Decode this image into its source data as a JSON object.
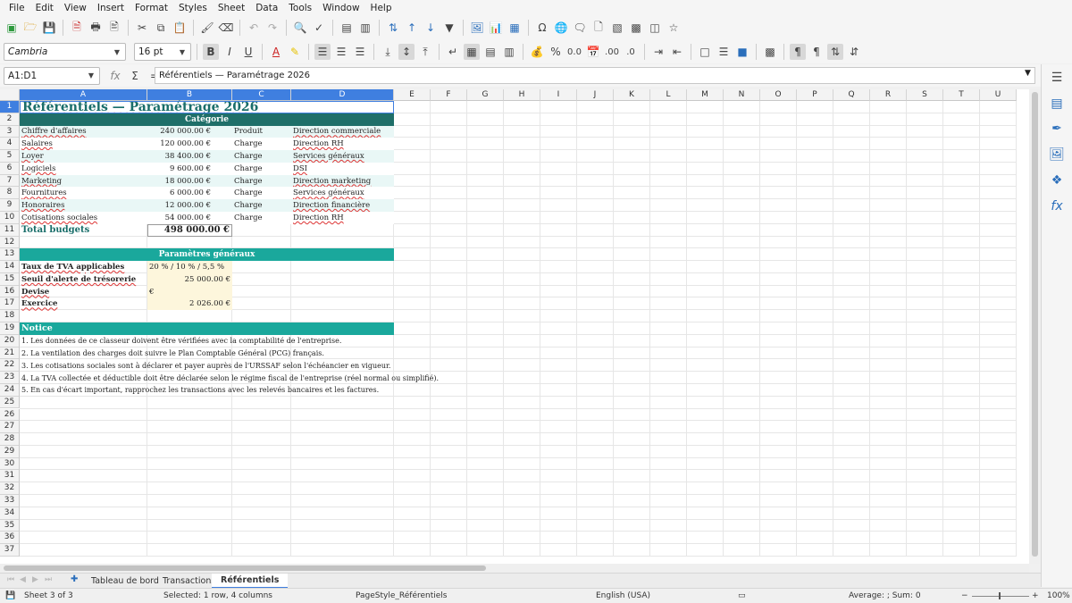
{
  "menu": [
    "File",
    "Edit",
    "View",
    "Insert",
    "Format",
    "Styles",
    "Sheet",
    "Data",
    "Tools",
    "Window",
    "Help"
  ],
  "font_name": "Cambria",
  "font_size": "16 pt",
  "name_box": "A1:D1",
  "formula_text": "Référentiels — Paramétrage 2026",
  "columns": [
    "A",
    "B",
    "C",
    "D",
    "E",
    "F",
    "G",
    "H",
    "I",
    "J",
    "K",
    "L",
    "M",
    "N",
    "O",
    "P",
    "Q",
    "R",
    "S",
    "T",
    "U"
  ],
  "rows": [
    "1",
    "2",
    "3",
    "4",
    "5",
    "6",
    "7",
    "8",
    "9",
    "10",
    "11",
    "12",
    "13",
    "14",
    "15",
    "16",
    "17",
    "18",
    "19",
    "20",
    "21",
    "22",
    "23",
    "24",
    "25",
    "26",
    "27",
    "28",
    "29",
    "30",
    "31",
    "32",
    "33",
    "34",
    "35",
    "36",
    "37"
  ],
  "sheet": {
    "title": "Référentiels — Paramétrage 2026",
    "category_header": "Catégorie",
    "budget_rows": [
      {
        "a": "Chiffre d'affaires",
        "b": "240 000.00 €",
        "c": "Produit",
        "d": "Direction commerciale"
      },
      {
        "a": "Salaires",
        "b": "120 000.00 €",
        "c": "Charge",
        "d": "Direction RH"
      },
      {
        "a": "Loyer",
        "b": "38 400.00 €",
        "c": "Charge",
        "d": "Services généraux"
      },
      {
        "a": "Logiciels",
        "b": "9 600.00 €",
        "c": "Charge",
        "d": "DSI"
      },
      {
        "a": "Marketing",
        "b": "18 000.00 €",
        "c": "Charge",
        "d": "Direction marketing"
      },
      {
        "a": "Fournitures",
        "b": "6 000.00 €",
        "c": "Charge",
        "d": "Services généraux"
      },
      {
        "a": "Honoraires",
        "b": "12 000.00 €",
        "c": "Charge",
        "d": "Direction financière"
      },
      {
        "a": "Cotisations sociales",
        "b": "54 000.00 €",
        "c": "Charge",
        "d": "Direction RH"
      }
    ],
    "total_label": "Total budgets",
    "total_value": "498 000.00 €",
    "params_header": "Paramètres généraux",
    "params": [
      {
        "label": "Taux de TVA applicables",
        "value": "20 % / 10 % / 5,5 %",
        "align": "left"
      },
      {
        "label": "Seuil d'alerte de trésorerie",
        "value": "25 000.00 €",
        "align": "right"
      },
      {
        "label": "Devise",
        "value": "€",
        "align": "left"
      },
      {
        "label": "Exercice",
        "value": "2 026.00 €",
        "align": "right"
      }
    ],
    "notice_header": "Notice",
    "notices": [
      "1. Les données de ce classeur doivent être vérifiées avec la comptabilité de l'entreprise.",
      "2. La ventilation des charges doit suivre le Plan Comptable Général (PCG) français.",
      "3. Les cotisations sociales sont à déclarer et payer auprès de l'URSSAF selon l'échéancier en vigueur.",
      "4. La TVA collectée et déductible doit être déclarée selon le régime fiscal de l'entreprise (réel normal ou simplifié).",
      "5. En cas d'écart important, rapprochez les transactions avec les relevés bancaires et les factures."
    ]
  },
  "tabs": [
    "Tableau de bord",
    "Transactions",
    "Référentiels"
  ],
  "status": {
    "sheet": "Sheet 3 of 3",
    "selection": "Selected: 1 row, 4 columns",
    "page_style": "PageStyle_Référentiels",
    "language": "English (USA)",
    "summary": "Average: ; Sum: 0",
    "zoom": "100%"
  },
  "colors": {
    "title_text": "#1a6e6a",
    "dark_teal": "#1f6f69",
    "teal": "#1aa89c",
    "row_tint": "#e9f7f6",
    "param_fill": "#fdf6dc",
    "select_blue": "#3f7fe0"
  }
}
